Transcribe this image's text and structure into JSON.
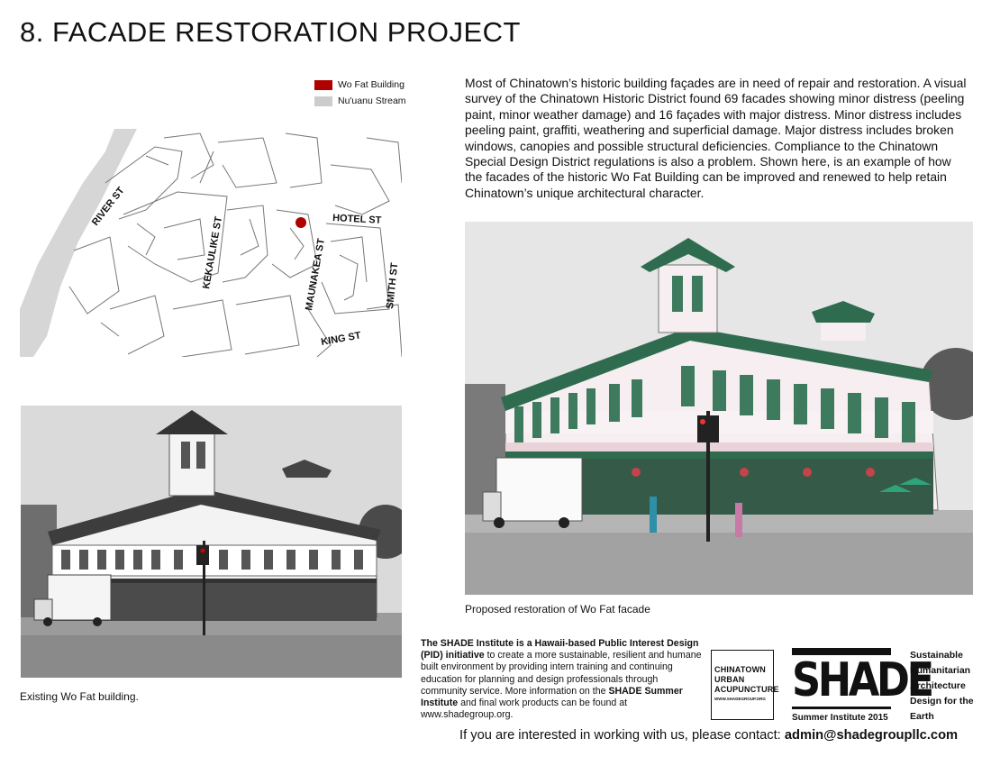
{
  "page": {
    "title": "8. FACADE RESTORATION PROJECT"
  },
  "legend": {
    "items": [
      {
        "label": "Wo Fat Building",
        "color": "#b00000"
      },
      {
        "label": "Nu'uanu Stream",
        "color": "#cccccc"
      }
    ]
  },
  "map": {
    "streets": [
      "RIVER ST",
      "KEKAULIKE ST",
      "HOTEL ST",
      "MAUNAKEA ST",
      "SMITH ST",
      "KING ST"
    ],
    "marker_color": "#b00000",
    "stream_color": "#d6d6d6"
  },
  "description": {
    "text": "Most of Chinatown’s historic building façades are in need of repair and restoration. A visual survey of the Chinatown Historic District found 69 facades showing minor distress (peeling paint, minor weather damage) and 16 façades with major distress. Minor distress includes peeling paint, graffiti, weathering and superficial damage. Major distress includes broken windows, canopies and possible structural deficiencies. Compliance to the Chinatown Special Design District regulations is also a problem. Shown here, is an example of how the facades of the historic Wo Fat Building can be improved and renewed to help retain Chinatown’s unique architectural character."
  },
  "photos": {
    "existing_caption": "Existing Wo Fat building.",
    "proposed_caption": "Proposed restoration of Wo Fat facade"
  },
  "shade_info": {
    "p1_bold": "The SHADE Institute is a Hawaii-based Public Interest Design (PID) initiative",
    "p1_rest": " to create a more sustainable, resilient and humane built environment by providing intern training and continuing education for planning and design professionals through community service. More information on the ",
    "p1_bold2": "SHADE Summer Institute",
    "p1_end": " and final work products can be found at www.shadegroup.org."
  },
  "logos": {
    "chinatown_line1": "CHINATOWN",
    "chinatown_line2": "URBAN",
    "chinatown_line3": "ACUPUNCTURE",
    "chinatown_url": "WWW.SHADEGROUP.ORG",
    "shade_word": "SHADE",
    "shade_sub": "Summer Institute 2015",
    "tagline": [
      "Sustainable",
      "Humanitarian",
      "Architecture",
      "Design for the",
      "Earth"
    ]
  },
  "contact": {
    "prompt": "If you are interested in working with us, please contact:",
    "email": "admin@shadegroupllc.com"
  }
}
